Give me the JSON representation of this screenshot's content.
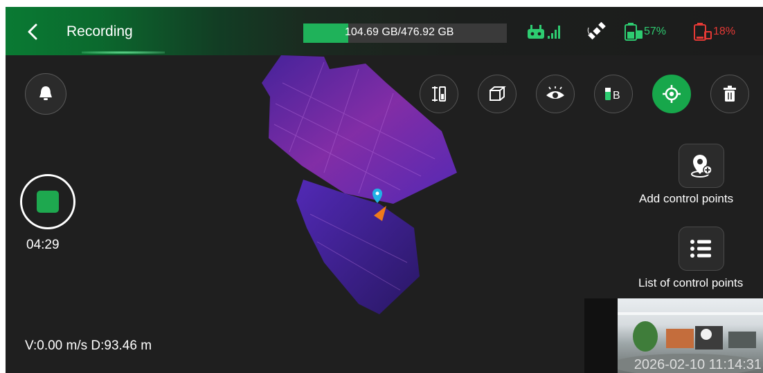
{
  "header": {
    "title": "Recording",
    "storage_text": "104.69 GB/476.92 GB",
    "storage_used_fraction": 0.22,
    "battery1_pct": "57%",
    "battery2_pct": "18%"
  },
  "icons": {
    "back": "chevron-left-icon",
    "controller_signal": "controller-signal-icon",
    "satellite": "satellite-icon",
    "battery_green": "battery-charging-icon",
    "battery_red": "battery-low-icon",
    "bell": "bell-icon",
    "toolbar": [
      "sliders-icon",
      "cube-icon",
      "eye-icon",
      "battery-b-icon",
      "target-icon",
      "trash-icon"
    ]
  },
  "left": {
    "timer": "04:29",
    "speed_distance": "V:0.00 m/s  D:93.46 m"
  },
  "right": {
    "add_control_points": "Add control points",
    "list_control_points": "List of control points"
  },
  "preview": {
    "timestamp": "2026-02-10 11:14:31"
  },
  "colors": {
    "accent": "#1ea84f",
    "battery_green": "#2ecc71",
    "battery_red": "#e53935",
    "map_purple": "#6a2fd6",
    "map_magenta": "#b23ab8"
  }
}
